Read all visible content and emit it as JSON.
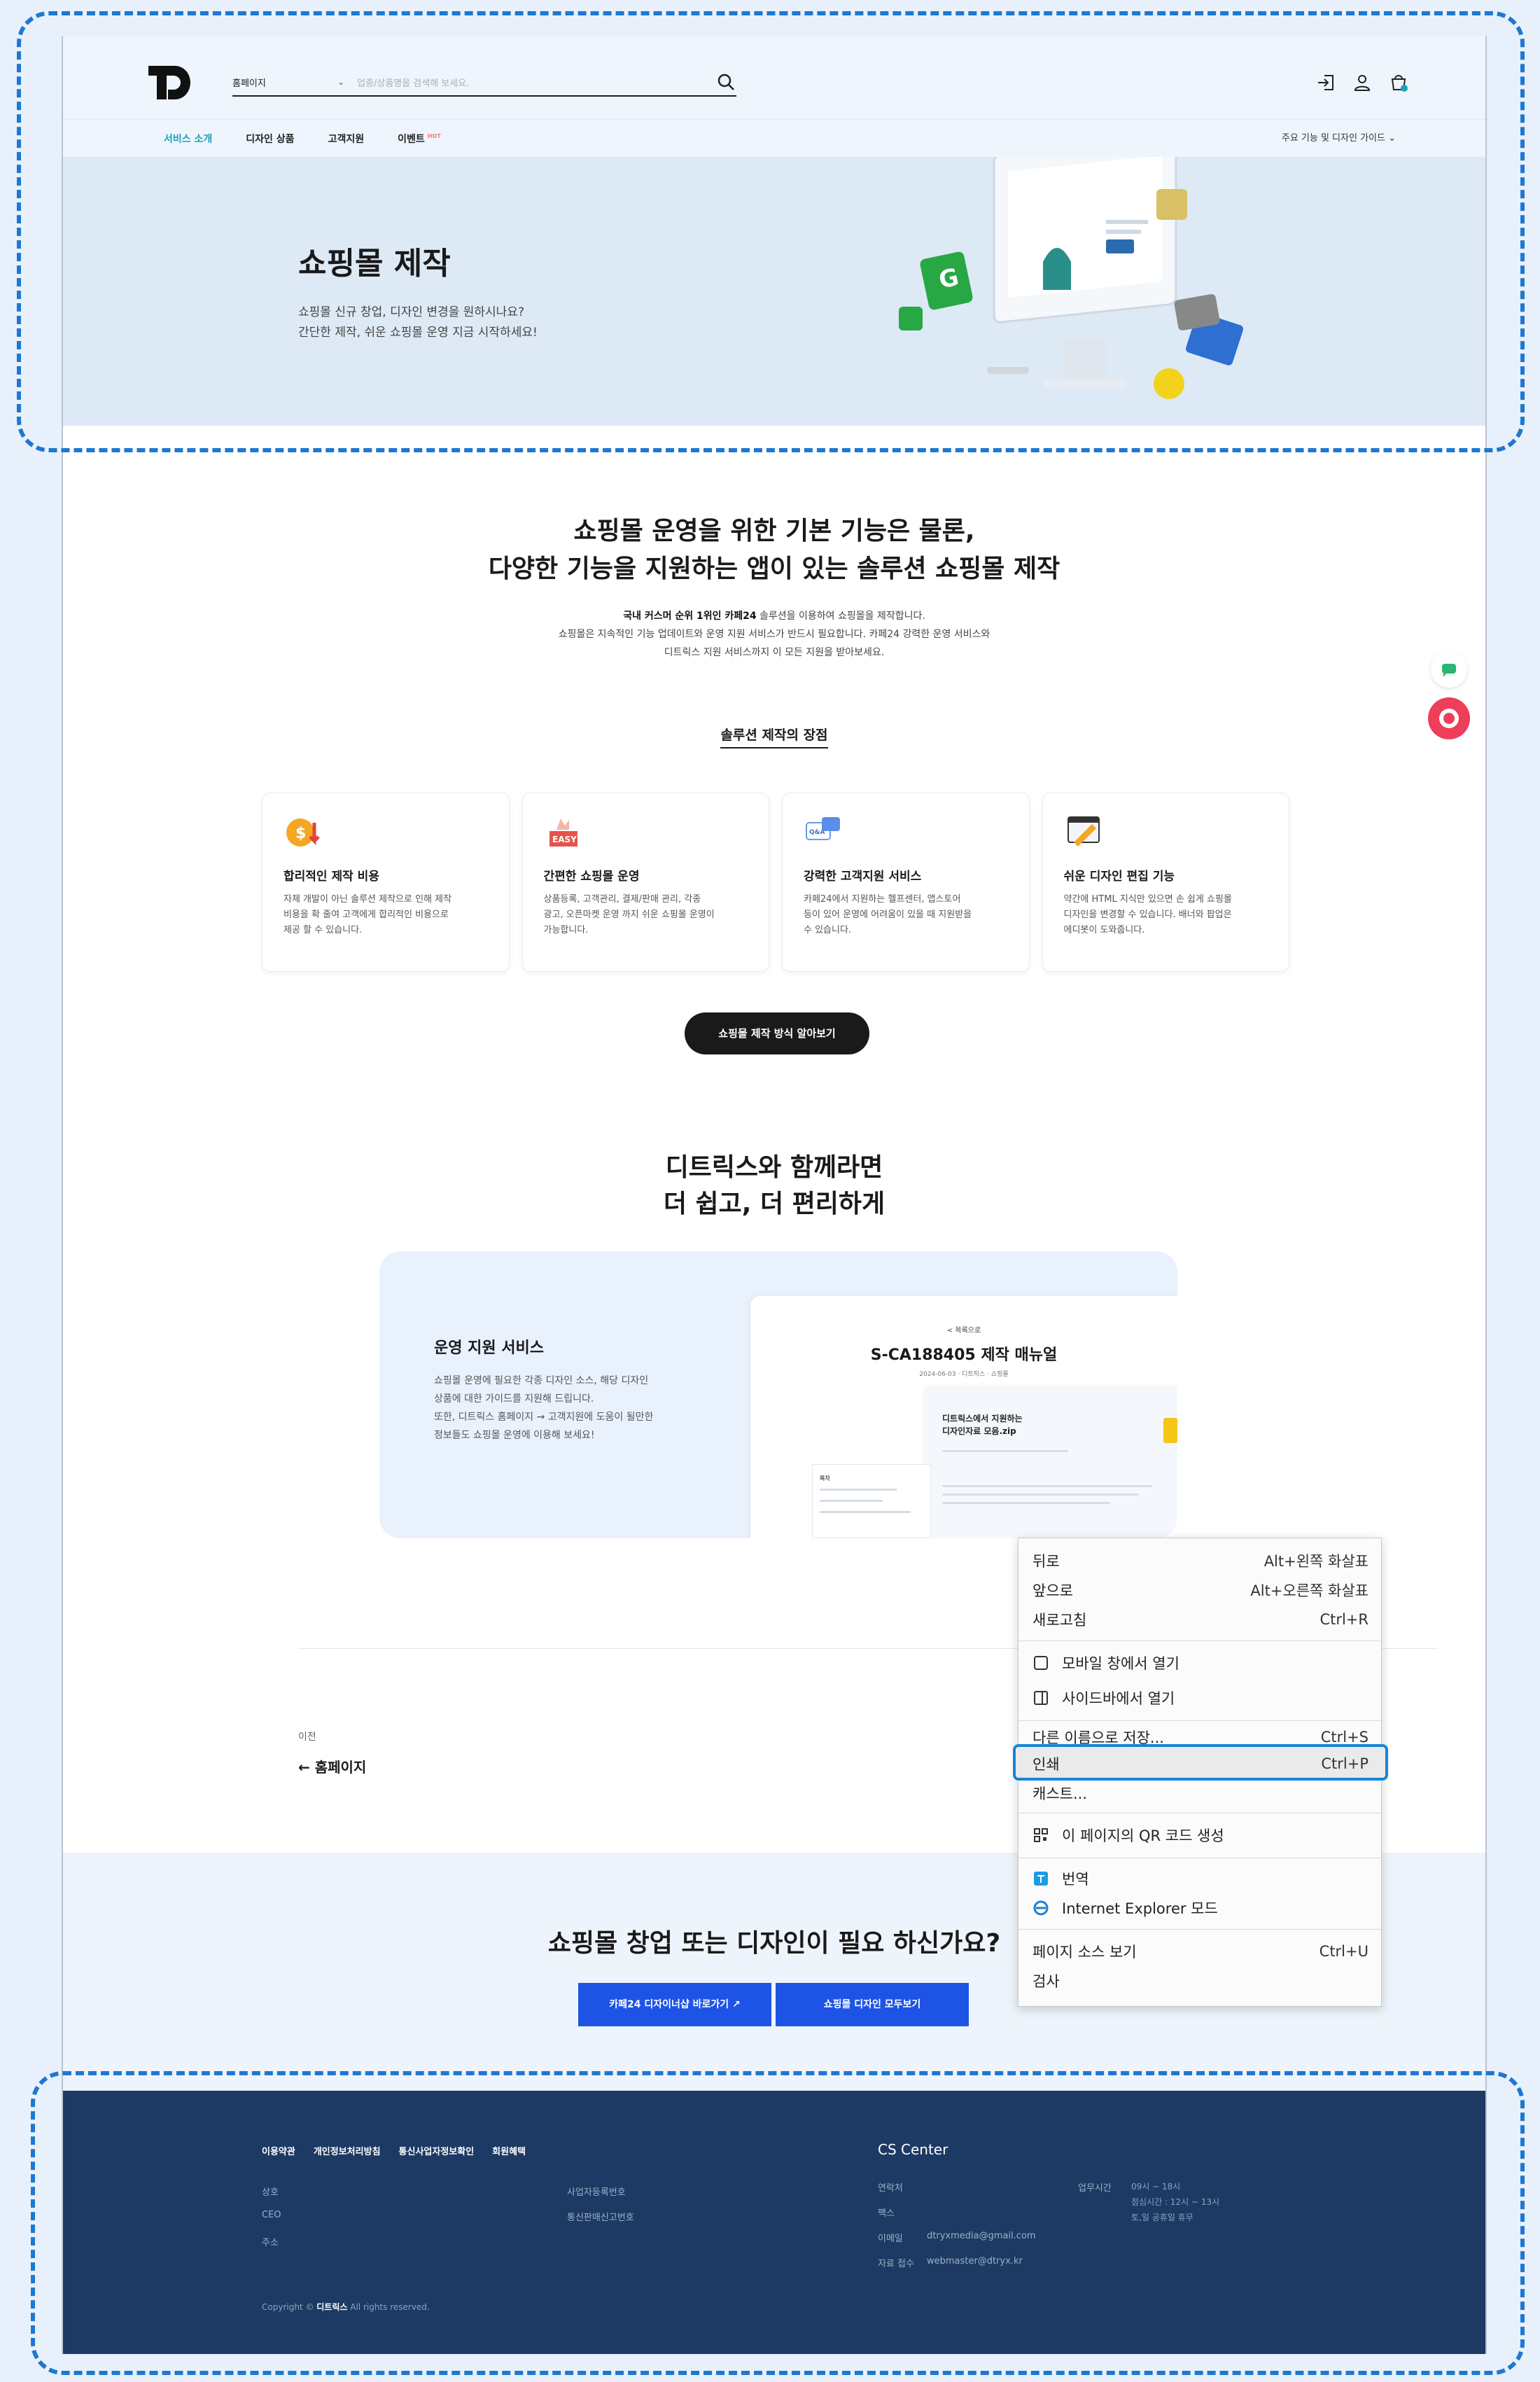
{
  "header": {
    "site_select": "홈페이지",
    "search_placeholder": "업종/상품명을 검색해 보세요.",
    "gnb": [
      "서비스 소개",
      "디자인 상품",
      "고객지원",
      "이벤트"
    ],
    "hot": "HOT",
    "guide": "주요 기능 및 디자인 가이드"
  },
  "hero": {
    "title": "쇼핑몰 제작",
    "sub1": "쇼핑몰 신규 창업, 디자인 변경을 원하시나요?",
    "sub2": "간단한 제작, 쉬운 쇼핑몰 운영 지금 시작하세요!"
  },
  "intro": {
    "h1": "쇼핑몰 운영을 위한 기본 기능은 물론,",
    "h2": "다양한 기능을 지원하는 앱이 있는 솔루션 쇼핑몰 제작",
    "p1_bold": "국내 커스머 순위 1위인 카페24",
    "p1_rest": " 솔루션을 이용하여 쇼핑몰을 제작합니다.",
    "p2": "쇼핑몰은 지속적인 기능 업데이트와 운영 지원 서비스가 반드시 필요합니다. 카페24 강력한 운영 서비스와",
    "p3": "디트릭스 지원 서비스까지 이 모든 지원을 받아보세요.",
    "merit_title": "솔루션 제작의 장점"
  },
  "cards": [
    {
      "title": "합리적인 제작 비용",
      "l1": "자체 개발이 아닌 솔루션 제작으로 인해 제작",
      "l2": "비용을 확 줄여 고객에게 합리적인 비용으로",
      "l3": "제공 할 수 있습니다."
    },
    {
      "title": "간편한 쇼핑몰 운영",
      "l1": "상품등록, 고객관리, 결제/판매 관리, 각종",
      "l2": "광고, 오픈마켓 운영 까지 쉬운 쇼핑몰 운영이",
      "l3": "가능합니다."
    },
    {
      "title": "강력한 고객지원 서비스",
      "l1": "카페24에서 지원하는 헬프센터, 앱스토어",
      "l2": "등이 있어 운영에 어려움이 있을 때 지원받을",
      "l3": "수 있습니다."
    },
    {
      "title": "쉬운 디자인 편집 기능",
      "l1": "약간에 HTML 지식만 있으면 손 쉽게 쇼핑몰",
      "l2": "디자인을 변경할 수 있습니다. 배너와 팝업은",
      "l3": "에디봇이 도와줍니다."
    }
  ],
  "card_badges": {
    "easy": "EASY",
    "qna": "Q&A"
  },
  "pill_button": "쇼핑몰 제작 방식 알아보기",
  "with": {
    "h1": "디트릭스와 함께라면",
    "h2": "더 쉽고, 더 편리하게"
  },
  "support": {
    "title": "운영 지원 서비스",
    "l1": "쇼핑몰 운영에 필요한 각종 디자인 소스, 해당 디자인",
    "l2": "상품에 대한 가이드를 지원해 드립니다.",
    "l3": "또한, 디트릭스 홈페이지 → 고객지원에 도움이 될만한",
    "l4": "정보들도 쇼핑몰 운영에 이용해 보세요!",
    "manual_back": "< 목록으로",
    "manual_title": "S-CA188405 제작 매뉴얼",
    "manual_meta": "2024-06-03  ·  디트릭스  ·  쇼핑몰",
    "zip_title1": "디트릭스에서 지원하는",
    "zip_title2": "디자인자료 모음.zip",
    "toc_title": "목차"
  },
  "prev": {
    "label": "이전",
    "link": "← 홈페이지"
  },
  "cta": {
    "title": "쇼핑몰 창업 또는 디자인이 필요 하신가요?",
    "btn1": "카페24 디자이너샵 바로가기 ↗",
    "btn2": "쇼핑몰 디자인 모두보기"
  },
  "footer": {
    "links": [
      "이용약관",
      "개인정보처리방침",
      "통신사업자정보확인",
      "회원혜택"
    ],
    "left_keys": [
      "상호",
      "CEO",
      "주소"
    ],
    "mid_keys": [
      "사업자등록번호",
      "통신판매신고번호"
    ],
    "cs_title": "CS Center",
    "cs_keys": [
      "연락처",
      "팩스",
      "이메일",
      "자료 접수"
    ],
    "email": "dtryxmedia@gmail.com",
    "upload": "webmaster@dtryx.kr",
    "hours_key": "업무시간",
    "hours1": "09시 ~ 18시",
    "hours2": "점심시간 : 12시 ~ 13시",
    "hours3": "토,일 공휴일 휴무",
    "copy_pre": "Copyright © ",
    "copy_brand": "디트릭스",
    "copy_post": " All rights reserved."
  },
  "context_menu": {
    "back": "뒤로",
    "back_sc": "Alt+왼쪽 화살표",
    "forward": "앞으로",
    "forward_sc": "Alt+오른쪽 화살표",
    "reload": "새로고침",
    "reload_sc": "Ctrl+R",
    "mobile": "모바일 창에서 열기",
    "sidebar": "사이드바에서 열기",
    "save": "다른 이름으로 저장...",
    "save_sc": "Ctrl+S",
    "print": "인쇄",
    "print_sc": "Ctrl+P",
    "cast": "캐스트...",
    "qr": "이 페이지의 QR 코드 생성",
    "translate": "번역",
    "ie": "Internet Explorer 모드",
    "source": "페이지 소스 보기",
    "source_sc": "Ctrl+U",
    "inspect": "검사"
  },
  "colors": {
    "accent": "#1e54e6",
    "teal": "#1ea0b8",
    "footer": "#1c3a64",
    "highlight": "#1e78d2"
  }
}
